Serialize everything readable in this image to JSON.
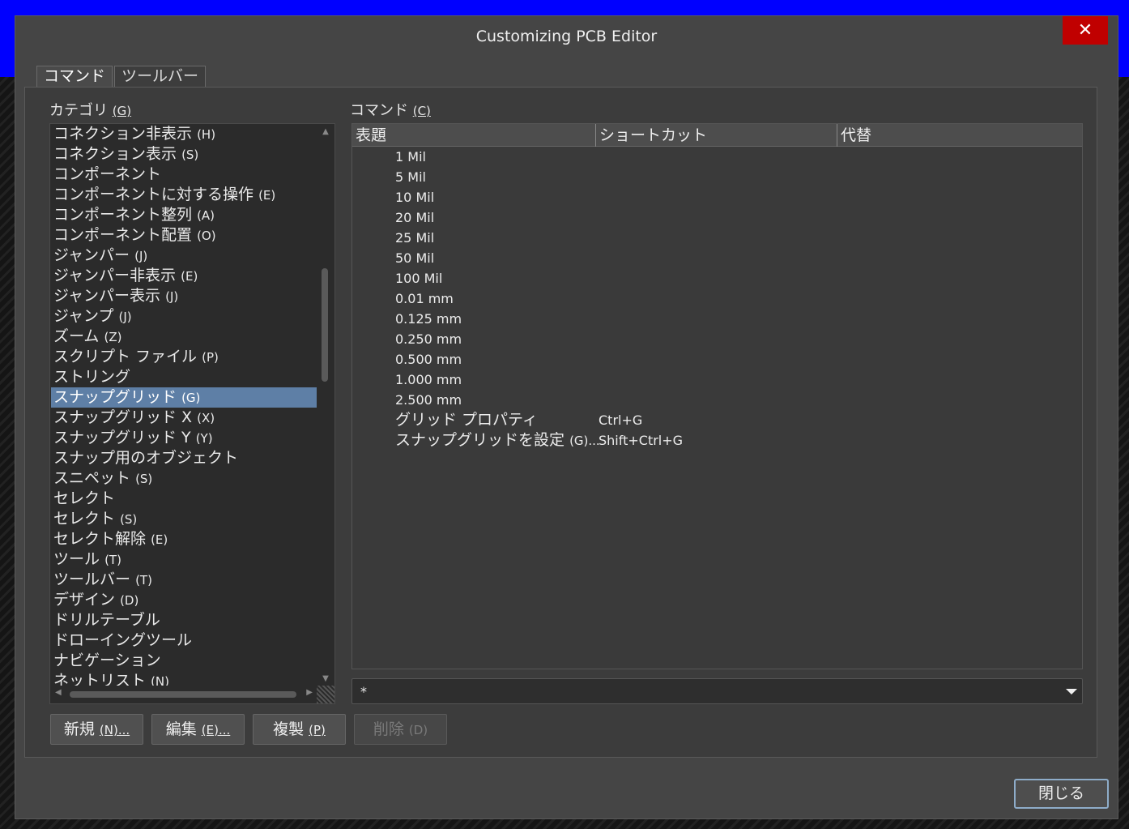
{
  "window": {
    "title": "Customizing PCB Editor",
    "close_symbol": "✕"
  },
  "tabs": [
    {
      "label": "コマンド",
      "active": true
    },
    {
      "label": "ツールバー",
      "active": false
    }
  ],
  "categories": {
    "label": "カテゴリ",
    "label_key": "(G)",
    "items": [
      {
        "name": "コネクション非表示",
        "key": "(H)"
      },
      {
        "name": "コネクション表示",
        "key": "(S)"
      },
      {
        "name": "コンポーネント",
        "key": ""
      },
      {
        "name": "コンポーネントに対する操作",
        "key": "(E)"
      },
      {
        "name": "コンポーネント整列",
        "key": "(A)"
      },
      {
        "name": "コンポーネント配置",
        "key": "(O)"
      },
      {
        "name": "ジャンパー",
        "key": "(J)"
      },
      {
        "name": "ジャンパー非表示",
        "key": "(E)"
      },
      {
        "name": "ジャンパー表示",
        "key": "(J)"
      },
      {
        "name": "ジャンプ",
        "key": "(J)"
      },
      {
        "name": "ズーム",
        "key": "(Z)"
      },
      {
        "name": "スクリプト ファイル",
        "key": "(P)"
      },
      {
        "name": "ストリング",
        "key": ""
      },
      {
        "name": "スナップグリッド",
        "key": "(G)",
        "selected": true
      },
      {
        "name": "スナップグリッド X",
        "key": "(X)"
      },
      {
        "name": "スナップグリッド Y",
        "key": "(Y)"
      },
      {
        "name": "スナップ用のオブジェクト",
        "key": ""
      },
      {
        "name": "スニペット",
        "key": "(S)"
      },
      {
        "name": "セレクト",
        "key": ""
      },
      {
        "name": "セレクト",
        "key": "(S)"
      },
      {
        "name": "セレクト解除",
        "key": "(E)"
      },
      {
        "name": "ツール",
        "key": "(T)"
      },
      {
        "name": "ツールバー",
        "key": "(T)"
      },
      {
        "name": "デザイン",
        "key": "(D)"
      },
      {
        "name": "ドリルテーブル",
        "key": ""
      },
      {
        "name": "ドローイングツール",
        "key": ""
      },
      {
        "name": "ナビゲーション",
        "key": ""
      },
      {
        "name": "ネットリスト",
        "key": "(N)"
      }
    ]
  },
  "commands": {
    "label": "コマンド",
    "label_key": "(C)",
    "columns": [
      "表題",
      "ショートカット",
      "代替"
    ],
    "rows": [
      {
        "title": "1 Mil",
        "key": "",
        "shortcut": "",
        "alt": ""
      },
      {
        "title": "5 Mil",
        "key": "",
        "shortcut": "",
        "alt": ""
      },
      {
        "title": "10 Mil",
        "key": "",
        "shortcut": "",
        "alt": ""
      },
      {
        "title": "20 Mil",
        "key": "",
        "shortcut": "",
        "alt": ""
      },
      {
        "title": "25 Mil",
        "key": "",
        "shortcut": "",
        "alt": ""
      },
      {
        "title": "50 Mil",
        "key": "",
        "shortcut": "",
        "alt": ""
      },
      {
        "title": "100 Mil",
        "key": "",
        "shortcut": "",
        "alt": ""
      },
      {
        "title": "0.01 mm",
        "key": "",
        "shortcut": "",
        "alt": ""
      },
      {
        "title": "0.125 mm",
        "key": "",
        "shortcut": "",
        "alt": ""
      },
      {
        "title": "0.250 mm",
        "key": "",
        "shortcut": "",
        "alt": ""
      },
      {
        "title": "0.500 mm",
        "key": "",
        "shortcut": "",
        "alt": ""
      },
      {
        "title": "1.000 mm",
        "key": "",
        "shortcut": "",
        "alt": ""
      },
      {
        "title": "2.500 mm",
        "key": "",
        "shortcut": "",
        "alt": ""
      },
      {
        "title": "グリッド プロパティ",
        "key": "",
        "shortcut": "Ctrl+G",
        "alt": ""
      },
      {
        "title": "スナップグリッドを設定",
        "key": "(G)...",
        "shortcut": "Shift+Ctrl+G",
        "alt": ""
      }
    ]
  },
  "filter": {
    "value": "*"
  },
  "buttons": {
    "new": {
      "label": "新規",
      "key": "(N)..."
    },
    "edit": {
      "label": "編集",
      "key": "(E)..."
    },
    "duplicate": {
      "label": "複製",
      "key": "(P)"
    },
    "delete": {
      "label": "削除",
      "key": "(D)",
      "disabled": true
    },
    "close": {
      "label": "閉じる"
    }
  },
  "colors": {
    "selection": "#5e7fa6",
    "close_button": "#c00000",
    "focus_border": "#8eacc9",
    "background_strip": "#0000ff"
  }
}
